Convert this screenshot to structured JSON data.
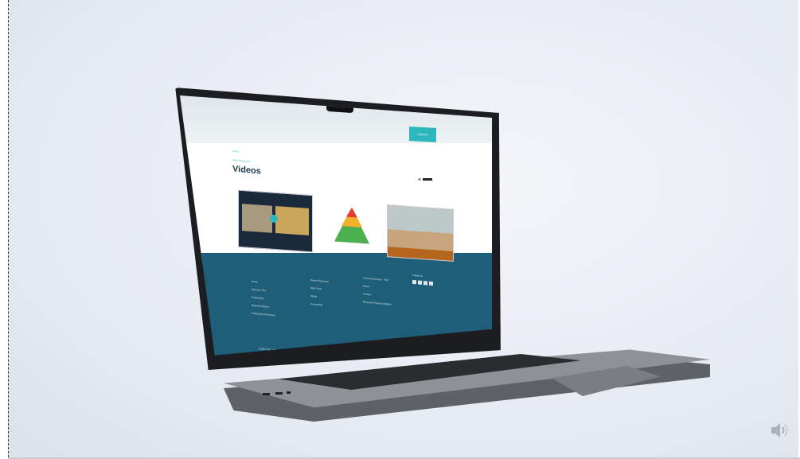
{
  "laptop_page": {
    "cta_label": "Subscribe",
    "breadcrumb": "Home",
    "subheading": "Video Resources",
    "title": "Videos",
    "footer": {
      "col1": [
        "Home",
        "Discover TEC",
        "Productivity",
        "Representations",
        "Professional Practices"
      ],
      "col2": [
        "Search Resource",
        "Math Tools",
        "Media",
        "Community"
      ],
      "col3": [
        "Cornell University · TEC",
        "About",
        "Contact",
        "Research Projects Institute"
      ],
      "col4_title": "Follow Us",
      "copyright": "© 2024 TEC. All rights reserved."
    }
  },
  "controls": {
    "speaker_icon": "speaker-volume-icon"
  }
}
